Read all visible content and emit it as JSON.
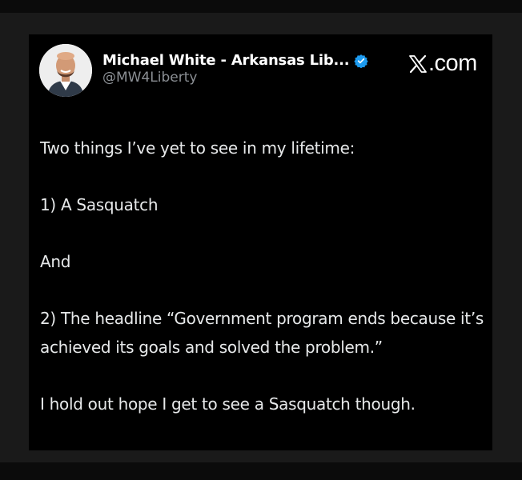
{
  "author": {
    "name": "Michael White - Arkansas Lib...",
    "handle": "@MW4Liberty",
    "verified_icon": "verified-badge-icon",
    "verified_color": "#1d9bf0"
  },
  "brand": {
    "logo_text": ".com",
    "logo_icon": "x-logo-icon"
  },
  "tweet": {
    "paragraphs": [
      "Two things I’ve yet to see in my lifetime:",
      "1) A Sasquatch",
      "And",
      "2) The headline “Government program ends because it’s achieved its goals and solved the problem.”",
      "I hold out hope I get to see a Sasquatch though."
    ]
  },
  "colors": {
    "card_background": "#000000",
    "frame_background": "#1a1a1a",
    "text_primary": "#e7e9ea",
    "text_secondary": "#8b8f94"
  }
}
